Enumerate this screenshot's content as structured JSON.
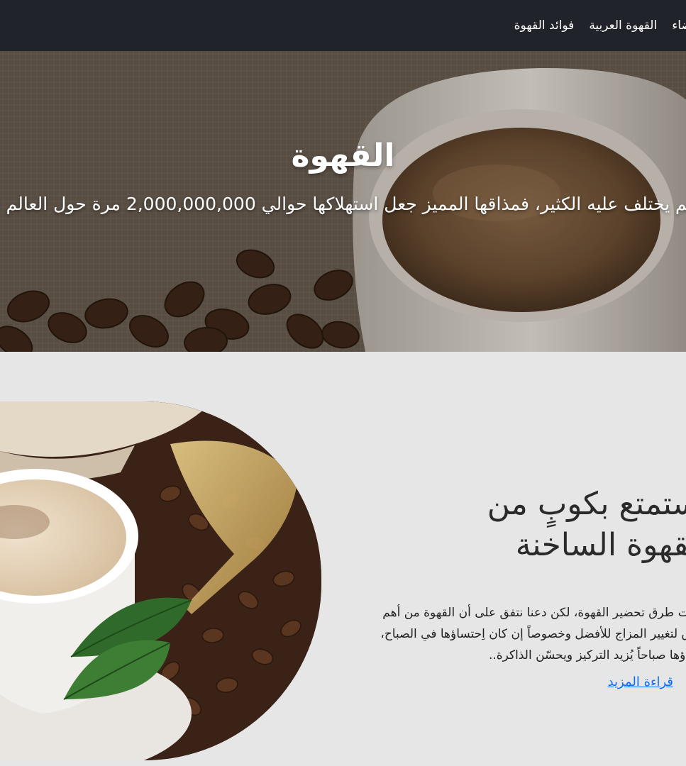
{
  "nav": {
    "items": [
      {
        "label": "أعضاء"
      },
      {
        "label": "القهوة العربية"
      },
      {
        "label": "فوائد القهوة"
      }
    ]
  },
  "hero": {
    "title": "القهوة",
    "text": "لم يختلف عليه الكثير، فمذاقها المميز جعل استهلاكها حوالي 2,000,000,000 مرة حول العالم !"
  },
  "feature": {
    "heading": "استمتع بكوبٍ من القهوة الساخنة",
    "text": "اختلفت طرق تحضير القهوة، لكن دعنا نتفق على أن القهوة من أهم الطرق لتغيير المزاج للأفضل وخصوصاً إن كان اِحتساؤها في الصباح، احتساؤها صباحاً يُزيد التركيز ويحسّن الذاكرة..",
    "link_label": "قراءة المزيد"
  },
  "colors": {
    "nav_background": "#202329",
    "page_background": "#e6e6e6",
    "link": "#0d6efd",
    "coffee_dark": "#3a2216"
  }
}
